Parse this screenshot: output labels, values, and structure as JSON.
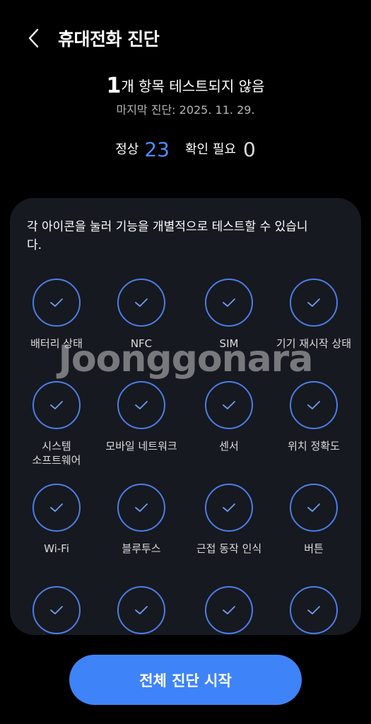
{
  "header": {
    "title": "휴대전화 진단",
    "back_icon": "back-arrow-icon"
  },
  "summary": {
    "count": "1",
    "text": "개 항목 테스트되지 않음",
    "last_diagnosis": "마지막 진단: 2025. 11. 29."
  },
  "stats": {
    "ok_label": "정상",
    "ok_value": "23",
    "check_label": "확인 필요",
    "check_value": "0"
  },
  "panel": {
    "description": "각 아이콘을 눌러 기능을 개별적으로 테스트할 수 있습니다."
  },
  "items": [
    {
      "label": "배터리 상태"
    },
    {
      "label": "NFC"
    },
    {
      "label": "SIM"
    },
    {
      "label": "기기 재시작 상태"
    },
    {
      "label": "시스템\n소프트웨어"
    },
    {
      "label": "모바일 네트워크"
    },
    {
      "label": "센서"
    },
    {
      "label": "위치 정확도"
    },
    {
      "label": "Wi-Fi"
    },
    {
      "label": "블루투스"
    },
    {
      "label": "근접 동작 인식"
    },
    {
      "label": "버튼"
    },
    {
      "label": ""
    },
    {
      "label": ""
    },
    {
      "label": ""
    },
    {
      "label": ""
    }
  ],
  "watermark": "Joonggonara",
  "start_button": {
    "label": "전체 진단 시작"
  },
  "colors": {
    "accent": "#3f83f8",
    "circle_border": "#4d7de8",
    "panel_bg": "#16191f"
  }
}
